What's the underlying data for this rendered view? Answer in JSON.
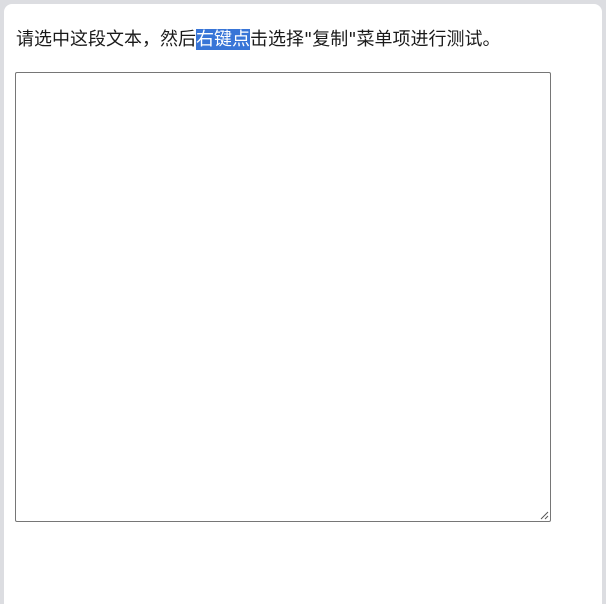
{
  "instruction": {
    "before_selection": "请选中这段文本，然后",
    "selected_text": "右键点",
    "after_selection": "击选择\"复制\"菜单项进行测试。"
  },
  "textarea": {
    "value": "",
    "placeholder": ""
  },
  "icons": {
    "resize_grip": "resize-grip-icon"
  },
  "colors": {
    "selection_background": "#3875d7",
    "selection_text": "#ffffff",
    "page_background": "#dcdde1"
  }
}
